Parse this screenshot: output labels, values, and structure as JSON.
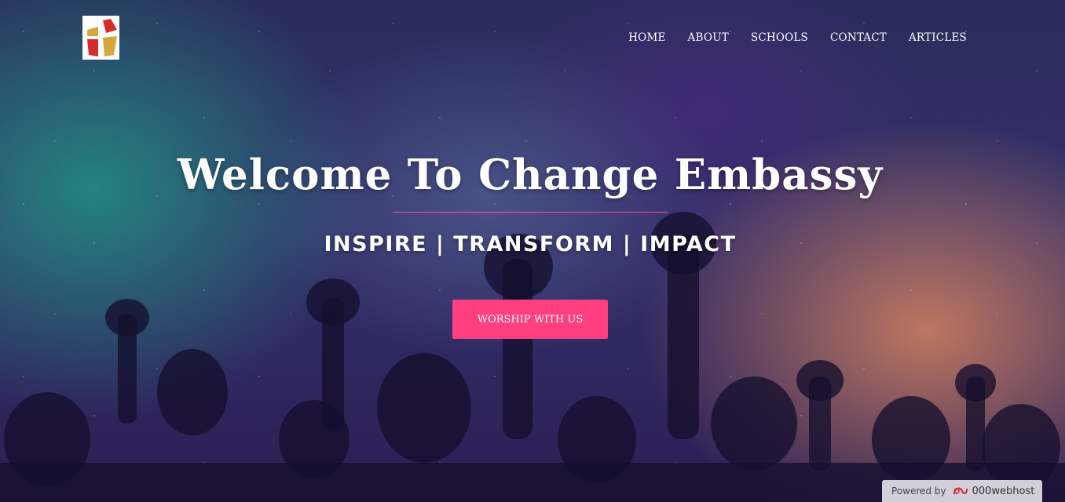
{
  "nav": {
    "logo_icon": "church-cross-logo-icon",
    "items": [
      {
        "label": "HOME"
      },
      {
        "label": "ABOUT"
      },
      {
        "label": "SCHOOLS"
      },
      {
        "label": "CONTACT"
      },
      {
        "label": "ARTICLES"
      }
    ]
  },
  "hero": {
    "title": "Welcome To Change Embassy",
    "tagline": "INSPIRE | TRANSFORM | IMPACT",
    "cta_label": "WORSHIP WITH US",
    "background": "starry-sky-concert-crowd-raised-hands"
  },
  "footer_badge": {
    "prefix": "Powered by",
    "brand": "000webhost",
    "brand_icon": "000webhost-logo-icon"
  },
  "colors": {
    "accent": "#ff3f80",
    "title_rule": "#ff4f8b",
    "text": "#ffffff"
  }
}
